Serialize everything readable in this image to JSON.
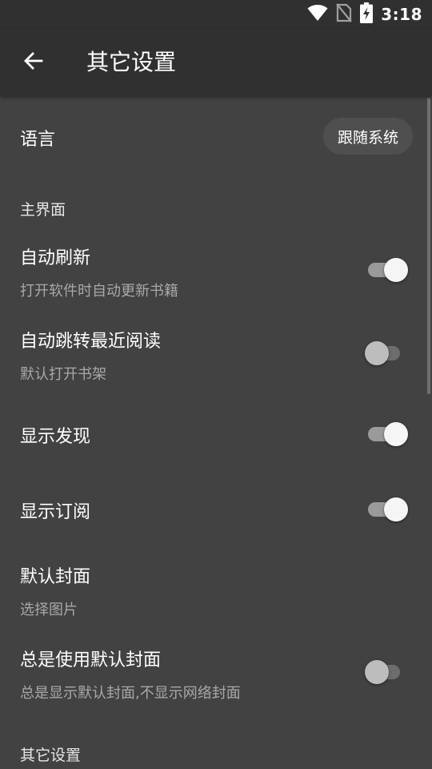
{
  "status_bar": {
    "time": "3:18"
  },
  "toolbar": {
    "title": "其它设置"
  },
  "language": {
    "label": "语言",
    "value": "跟随系统"
  },
  "sections": {
    "main": "主界面",
    "other": "其它设置"
  },
  "settings": {
    "auto_refresh": {
      "title": "自动刷新",
      "summary": "打开软件时自动更新书籍",
      "enabled": true
    },
    "auto_jump": {
      "title": "自动跳转最近阅读",
      "summary": "默认打开书架",
      "enabled": false
    },
    "show_discover": {
      "title": "显示发现",
      "enabled": true
    },
    "show_rss": {
      "title": "显示订阅",
      "enabled": true
    },
    "default_cover": {
      "title": "默认封面",
      "summary": "选择图片"
    },
    "always_default_cover": {
      "title": "总是使用默认封面",
      "summary": "总是显示默认封面,不显示网络封面",
      "enabled": false
    }
  }
}
